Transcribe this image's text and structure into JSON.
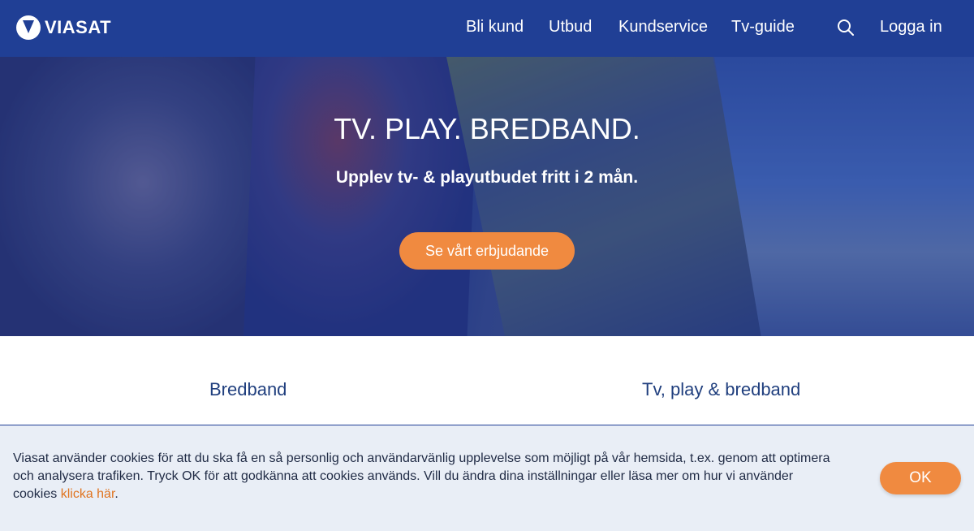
{
  "header": {
    "brand": "VIASAT",
    "nav": [
      {
        "label": "Bli kund"
      },
      {
        "label": "Utbud"
      },
      {
        "label": "Kundservice"
      },
      {
        "label": "Tv-guide"
      }
    ],
    "search_icon": "search-icon",
    "login_label": "Logga in",
    "background_color": "#203f95"
  },
  "hero": {
    "title": "TV. PLAY. BREDBAND.",
    "subtitle": "Upplev tv- & playutbudet fritt i 2 mån.",
    "cta_label": "Se vårt erbjudande",
    "cta_color": "#f08a40"
  },
  "tabs": [
    {
      "label": "Bredband"
    },
    {
      "label": "Tv, play & bredband"
    }
  ],
  "cookie": {
    "text": "Viasat använder cookies för att du ska få en så personlig och användarvänlig upplevelse som möjligt på vår hemsida, t.ex. genom att optimera och analysera trafiken. Tryck OK för att godkänna att cookies används. Vill du ändra dina inställningar eller läsa mer om hur vi använder cookies ",
    "link_label": "klicka här",
    "suffix": ".",
    "ok_label": "OK",
    "link_color": "#e07420"
  }
}
